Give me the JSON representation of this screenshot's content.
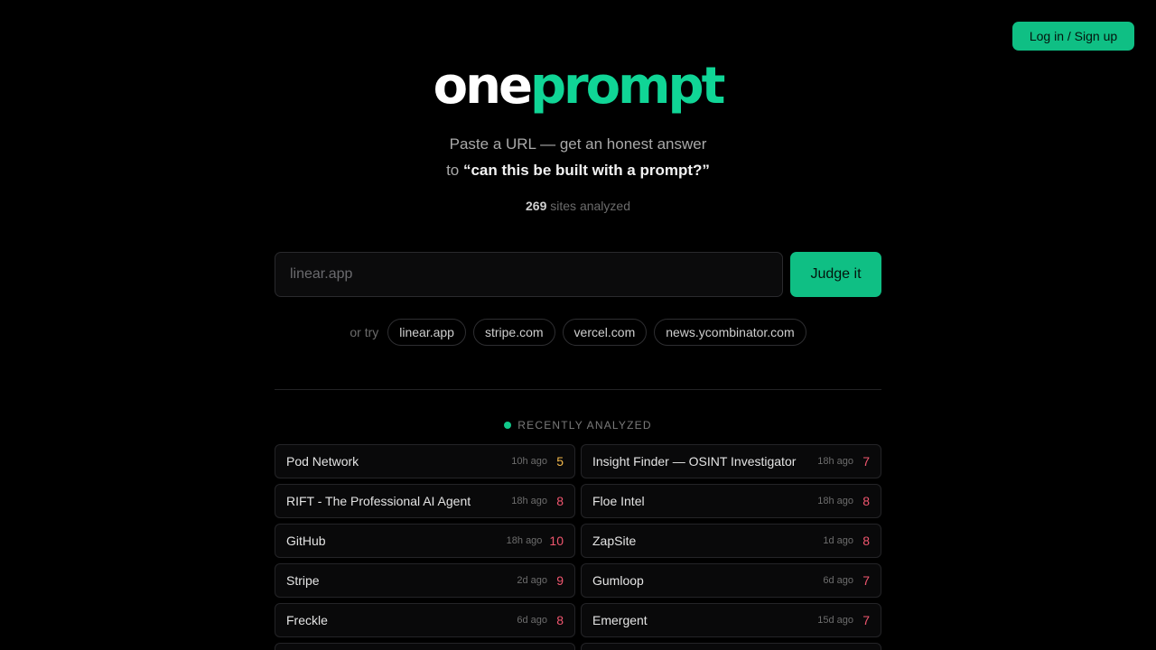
{
  "header": {
    "login_label": "Log in / Sign up"
  },
  "logo": {
    "part1": "one",
    "part2": "prompt"
  },
  "tagline": {
    "line1": "Paste a URL — get an honest answer",
    "line2_prefix": "to ",
    "line2_strong": "“can this be built with a prompt?”"
  },
  "stats": {
    "count": "269",
    "label": "sites analyzed"
  },
  "search": {
    "placeholder": "linear.app",
    "value": "",
    "submit_label": "Judge it"
  },
  "suggestions": {
    "label": "or try",
    "items": [
      "linear.app",
      "stripe.com",
      "vercel.com",
      "news.ycombinator.com"
    ]
  },
  "recent": {
    "heading": "RECENTLY ANALYZED",
    "colors": {
      "dot": "#10c98a",
      "score_mid": "#f2b84b",
      "score_high": "#f0566f"
    },
    "items": [
      {
        "name": "Pod Network",
        "ago": "10h ago",
        "score": "5",
        "level": "mid"
      },
      {
        "name": "Insight Finder — OSINT Investigator",
        "ago": "18h ago",
        "score": "7",
        "level": "high"
      },
      {
        "name": "RIFT - The Professional AI Agent",
        "ago": "18h ago",
        "score": "8",
        "level": "high"
      },
      {
        "name": "Floe Intel",
        "ago": "18h ago",
        "score": "8",
        "level": "high"
      },
      {
        "name": "GitHub",
        "ago": "18h ago",
        "score": "10",
        "level": "high"
      },
      {
        "name": "ZapSite",
        "ago": "1d ago",
        "score": "8",
        "level": "high"
      },
      {
        "name": "Stripe",
        "ago": "2d ago",
        "score": "9",
        "level": "high"
      },
      {
        "name": "Gumloop",
        "ago": "6d ago",
        "score": "7",
        "level": "high"
      },
      {
        "name": "Freckle",
        "ago": "6d ago",
        "score": "8",
        "level": "high"
      },
      {
        "name": "Emergent",
        "ago": "15d ago",
        "score": "7",
        "level": "high"
      },
      {
        "name": "",
        "ago": "",
        "score": "",
        "level": "high"
      },
      {
        "name": "",
        "ago": "",
        "score": "",
        "level": "high"
      }
    ]
  }
}
